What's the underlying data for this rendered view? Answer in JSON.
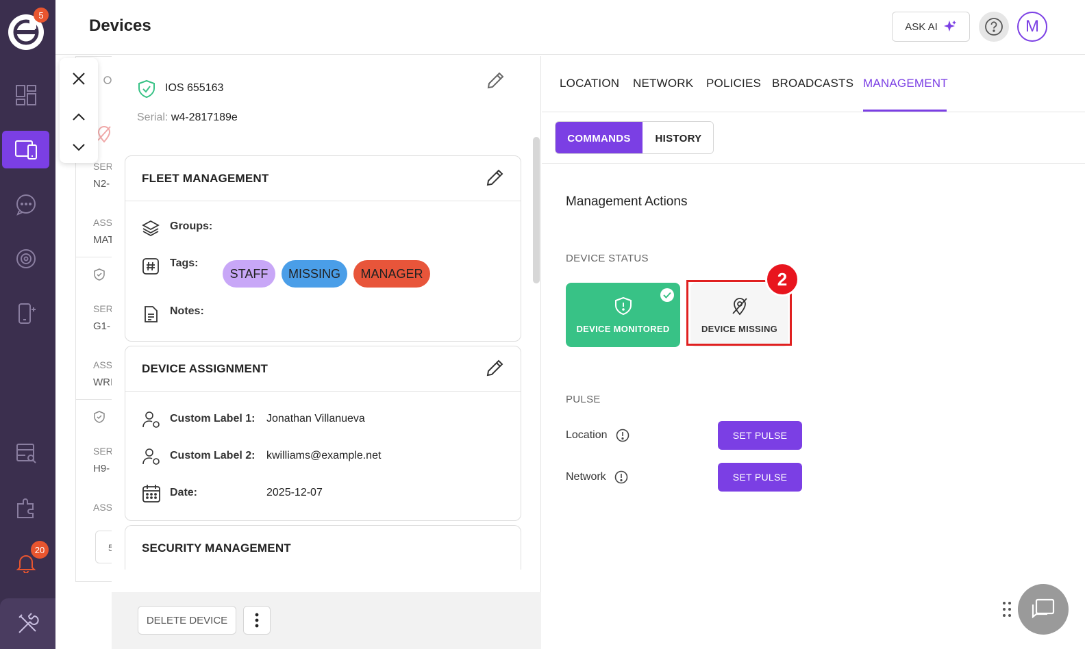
{
  "sidebar": {
    "logo_badge": "5",
    "notifications_badge": "20",
    "items": [
      {
        "icon": "dashboard-icon"
      },
      {
        "icon": "devices-icon",
        "active": true
      },
      {
        "icon": "messages-icon"
      },
      {
        "icon": "settings-cog-icon"
      },
      {
        "icon": "add-device-icon"
      },
      {
        "icon": "reports-icon"
      },
      {
        "icon": "integrations-puzzle-icon"
      },
      {
        "icon": "bell-icon"
      },
      {
        "icon": "tools-icon"
      }
    ]
  },
  "header": {
    "title": "Devices",
    "ask_ai_label": "ASK AI",
    "avatar_initial": "M"
  },
  "background_list": {
    "labels": [
      "SER",
      "N2-",
      "ASS",
      "MAT",
      "SER",
      "G1-",
      "ASS",
      "WRI",
      "SER",
      "H9-",
      "ASS"
    ],
    "stepper_value": "5"
  },
  "device": {
    "name": "IOS 655163",
    "serial_label": "Serial:",
    "serial_value": "w4-2817189e"
  },
  "fleet_management": {
    "title": "FLEET MANAGEMENT",
    "groups_label": "Groups:",
    "tags_label": "Tags:",
    "notes_label": "Notes:",
    "tags": [
      {
        "label": "STAFF",
        "color": "#c8a7f7"
      },
      {
        "label": "MISSING",
        "color": "#4a9ee8"
      },
      {
        "label": "MANAGER",
        "color": "#e8553a"
      }
    ]
  },
  "device_assignment": {
    "title": "DEVICE ASSIGNMENT",
    "custom_label_1": "Custom Label 1:",
    "custom_value_1": "Jonathan Villanueva",
    "custom_label_2": "Custom Label 2:",
    "custom_value_2": "kwilliams@example.net",
    "date_label": "Date:",
    "date_value": "2025-12-07"
  },
  "security_management": {
    "title": "SECURITY MANAGEMENT"
  },
  "footer": {
    "delete_label": "DELETE DEVICE"
  },
  "tabs": [
    {
      "label": "LOCATION"
    },
    {
      "label": "NETWORK"
    },
    {
      "label": "POLICIES"
    },
    {
      "label": "BROADCASTS"
    },
    {
      "label": "MANAGEMENT",
      "active": true
    }
  ],
  "subtabs": [
    {
      "label": "COMMANDS",
      "active": true
    },
    {
      "label": "HISTORY"
    }
  ],
  "management": {
    "title": "Management Actions",
    "device_status_label": "DEVICE STATUS",
    "monitored_label": "DEVICE MONITORED",
    "missing_label": "DEVICE MISSING",
    "step_number": "2",
    "pulse_label": "PULSE",
    "location_label": "Location",
    "network_label": "Network",
    "set_pulse_label": "SET PULSE"
  },
  "colors": {
    "accent": "#7b3fe4",
    "monitored": "#38c286",
    "sidebar": "#3b2f4e",
    "highlight": "#e02020"
  }
}
